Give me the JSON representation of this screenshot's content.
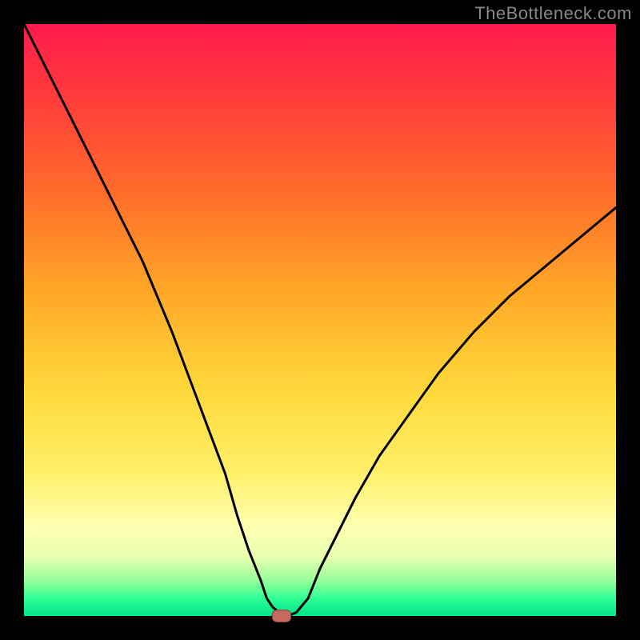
{
  "watermark": "TheBottleneck.com",
  "chart_data": {
    "type": "line",
    "title": "",
    "xlabel": "",
    "ylabel": "",
    "xlim": [
      0,
      100
    ],
    "ylim": [
      0,
      100
    ],
    "x": [
      0,
      5,
      10,
      15,
      20,
      25,
      28,
      31,
      34,
      36,
      38,
      40,
      41,
      42,
      43,
      44,
      45,
      46,
      48,
      50,
      53,
      56,
      60,
      65,
      70,
      76,
      82,
      88,
      94,
      100
    ],
    "values": [
      100,
      90,
      80,
      70,
      60,
      48,
      40,
      32,
      24,
      17,
      11,
      6,
      3,
      1.5,
      0.7,
      0.3,
      0.2,
      0.6,
      3,
      8,
      14,
      20,
      27,
      34,
      41,
      48,
      54,
      59,
      64,
      69
    ],
    "marker": {
      "x": 43.5,
      "y": 0
    },
    "gradient_colors": {
      "top": "#ff1a4d",
      "mid": "#ffd93b",
      "bottom": "#00e38a"
    }
  }
}
